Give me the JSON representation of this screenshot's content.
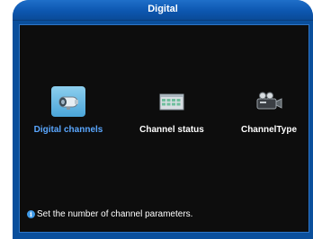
{
  "window": {
    "title": "Digital"
  },
  "menu": {
    "items": [
      {
        "label": "Digital channels",
        "icon": "camera-icon",
        "selected": true
      },
      {
        "label": "Channel status",
        "icon": "status-grid-icon",
        "selected": false
      },
      {
        "label": "ChannelType",
        "icon": "video-camera-icon",
        "selected": false
      }
    ]
  },
  "status": {
    "hint": "Set the number of channel parameters.",
    "icon": "info-icon"
  },
  "colors": {
    "frame": "#0a4f9c",
    "panel": "#0d0d0d",
    "selected_label": "#5aa7ff",
    "selected_icon_bg": "#4aa5d9"
  }
}
